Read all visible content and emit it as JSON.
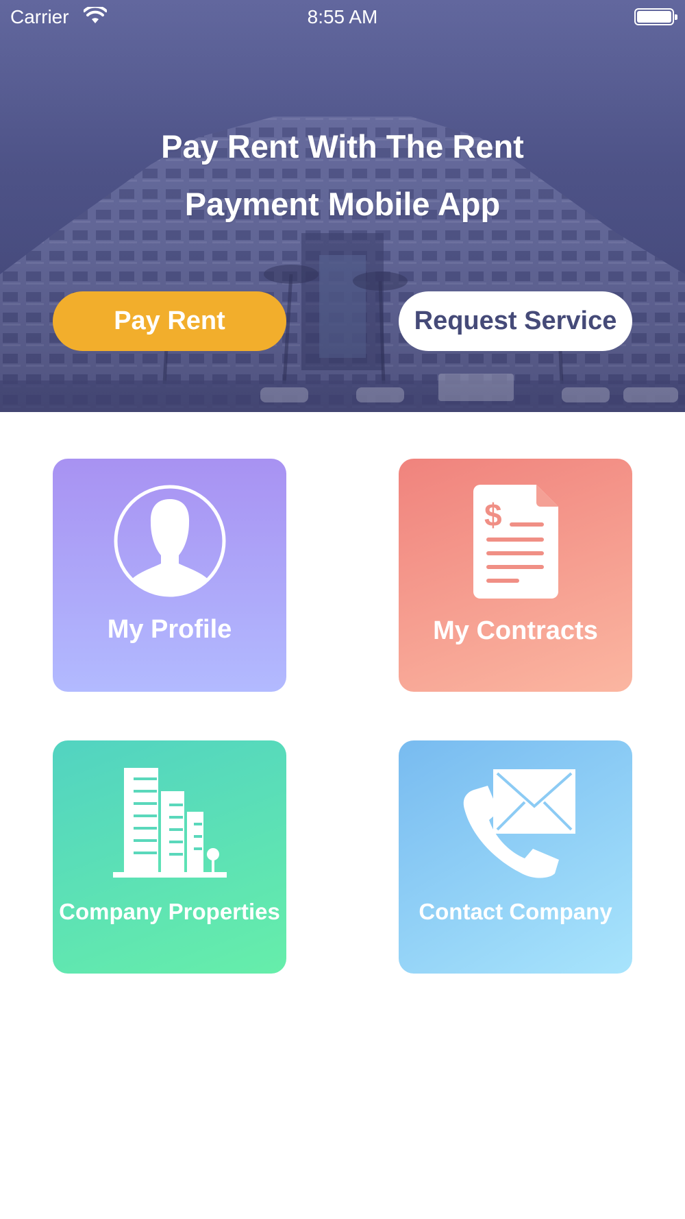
{
  "status_bar": {
    "carrier": "Carrier",
    "time": "8:55 AM",
    "icons": [
      "wifi-icon",
      "battery-icon"
    ]
  },
  "hero": {
    "title_line1": "Pay Rent With The Rent",
    "title_line2": "Payment Mobile App",
    "pay_rent_label": "Pay Rent",
    "request_service_label": "Request Service"
  },
  "tiles": [
    {
      "label": "My Profile",
      "icon": "user-profile-icon",
      "colors": [
        "#a892f2",
        "#b2baff"
      ]
    },
    {
      "label": "My Contracts",
      "icon": "contract-document-icon",
      "colors": [
        "#f0837d",
        "#fbb6a1"
      ]
    },
    {
      "label": "Company Properties",
      "icon": "buildings-icon",
      "colors": [
        "#52d3c1",
        "#66eeaa"
      ]
    },
    {
      "label": "Contact Company",
      "icon": "phone-mail-icon",
      "colors": [
        "#78bbf0",
        "#a8e4fc"
      ]
    }
  ],
  "colors": {
    "hero_overlay": "#585d96",
    "pay_rent_button": "#f2ae2c",
    "request_service_text": "#454a78"
  }
}
